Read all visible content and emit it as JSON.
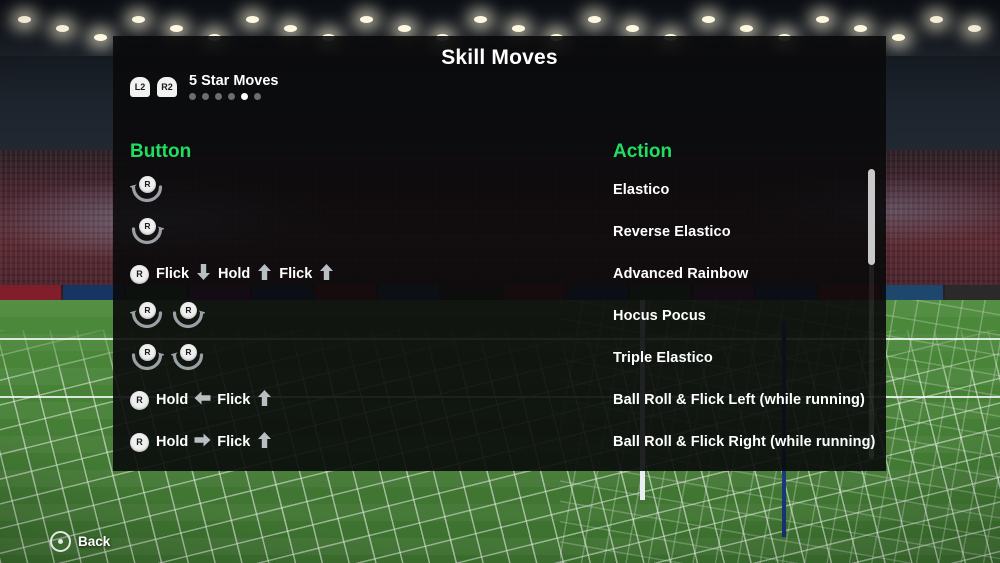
{
  "window": {
    "title": "Skill Moves"
  },
  "pager": {
    "left_trigger": "L2",
    "right_trigger": "R2",
    "label": "5 Star Moves",
    "total_pages": 6,
    "current_page": 5
  },
  "columns": {
    "button_header": "Button",
    "action_header": "Action"
  },
  "colors": {
    "header_green": "#21dd62",
    "panel_bg": "rgba(10,10,11,0.90)",
    "text_white": "#ffffff",
    "dot_inactive": "#6d6d6d",
    "scrollbar_thumb": "#c9c9c9"
  },
  "rows": [
    {
      "action": "Elastico",
      "tokens": [
        {
          "type": "stick",
          "label": "R",
          "arc": "left-arrow"
        }
      ]
    },
    {
      "action": "Reverse Elastico",
      "tokens": [
        {
          "type": "stick",
          "label": "R",
          "arc": "right-arrow"
        }
      ]
    },
    {
      "action": "Advanced Rainbow",
      "tokens": [
        {
          "type": "stick-plain",
          "label": "R"
        },
        {
          "type": "text",
          "label": "Flick"
        },
        {
          "type": "arrow",
          "dir": "down"
        },
        {
          "type": "text",
          "label": "Hold"
        },
        {
          "type": "arrow",
          "dir": "up"
        },
        {
          "type": "text",
          "label": "Flick"
        },
        {
          "type": "arrow",
          "dir": "up"
        }
      ]
    },
    {
      "action": "Hocus Pocus",
      "tokens": [
        {
          "type": "stick",
          "label": "R",
          "arc": "left-arrow"
        },
        {
          "type": "stick",
          "label": "R",
          "arc": "right-arrow"
        }
      ]
    },
    {
      "action": "Triple Elastico",
      "tokens": [
        {
          "type": "stick",
          "label": "R",
          "arc": "right-arrow"
        },
        {
          "type": "stick",
          "label": "R",
          "arc": "left-arrow"
        }
      ]
    },
    {
      "action": "Ball Roll & Flick Left (while running)",
      "tokens": [
        {
          "type": "stick-plain",
          "label": "R"
        },
        {
          "type": "text",
          "label": "Hold"
        },
        {
          "type": "arrow",
          "dir": "left"
        },
        {
          "type": "text",
          "label": "Flick"
        },
        {
          "type": "arrow",
          "dir": "up"
        }
      ]
    },
    {
      "action": "Ball Roll & Flick Right (while running)",
      "tokens": [
        {
          "type": "stick-plain",
          "label": "R"
        },
        {
          "type": "text",
          "label": "Hold"
        },
        {
          "type": "arrow",
          "dir": "right"
        },
        {
          "type": "text",
          "label": "Flick"
        },
        {
          "type": "arrow",
          "dir": "up"
        }
      ]
    }
  ],
  "footer": {
    "back_label": "Back",
    "back_icon": "circle-button-icon"
  }
}
